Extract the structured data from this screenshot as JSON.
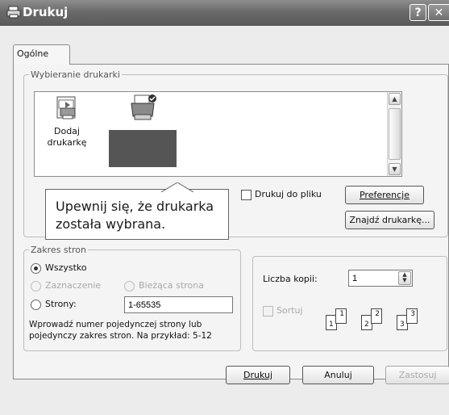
{
  "window": {
    "title": "Drukuj",
    "help_glyph": "?",
    "close_glyph": "✕"
  },
  "tabs": [
    {
      "label": "Ogólne"
    }
  ],
  "printer_select": {
    "legend": "Wybieranie drukarki",
    "printers": [
      {
        "label": "Dodaj drukarkę"
      },
      {
        "label": "",
        "selected": true
      }
    ],
    "print_to_file_label": "Drukuj do pliku",
    "print_to_file_checked": false,
    "preferences_button": "Preferencje",
    "find_printer_button": "Znajdź drukarkę..."
  },
  "callout": {
    "text_line1": "Upewnij się, że drukarka",
    "text_line2": "została wybrana."
  },
  "page_range": {
    "legend": "Zakres stron",
    "all_label": "Wszystko",
    "selection_label": "Zaznaczenie",
    "current_page_label": "Bieżąca strona",
    "pages_label": "Strony:",
    "pages_value": "1-65535",
    "hint_line1": "Wprowadź numer pojedynczej strony lub",
    "hint_line2": "pojedynczy zakres stron. Na przykład: 5-12"
  },
  "copies": {
    "count_label": "Liczba kopii:",
    "count_value": "1",
    "collate_label": "Sortuj",
    "collate_checked": false,
    "collate_pages": [
      "1",
      "1",
      "2",
      "2",
      "3",
      "3"
    ]
  },
  "footer": {
    "print_button": "Drukuj",
    "cancel_button": "Anuluj",
    "apply_button": "Zastosuj"
  }
}
